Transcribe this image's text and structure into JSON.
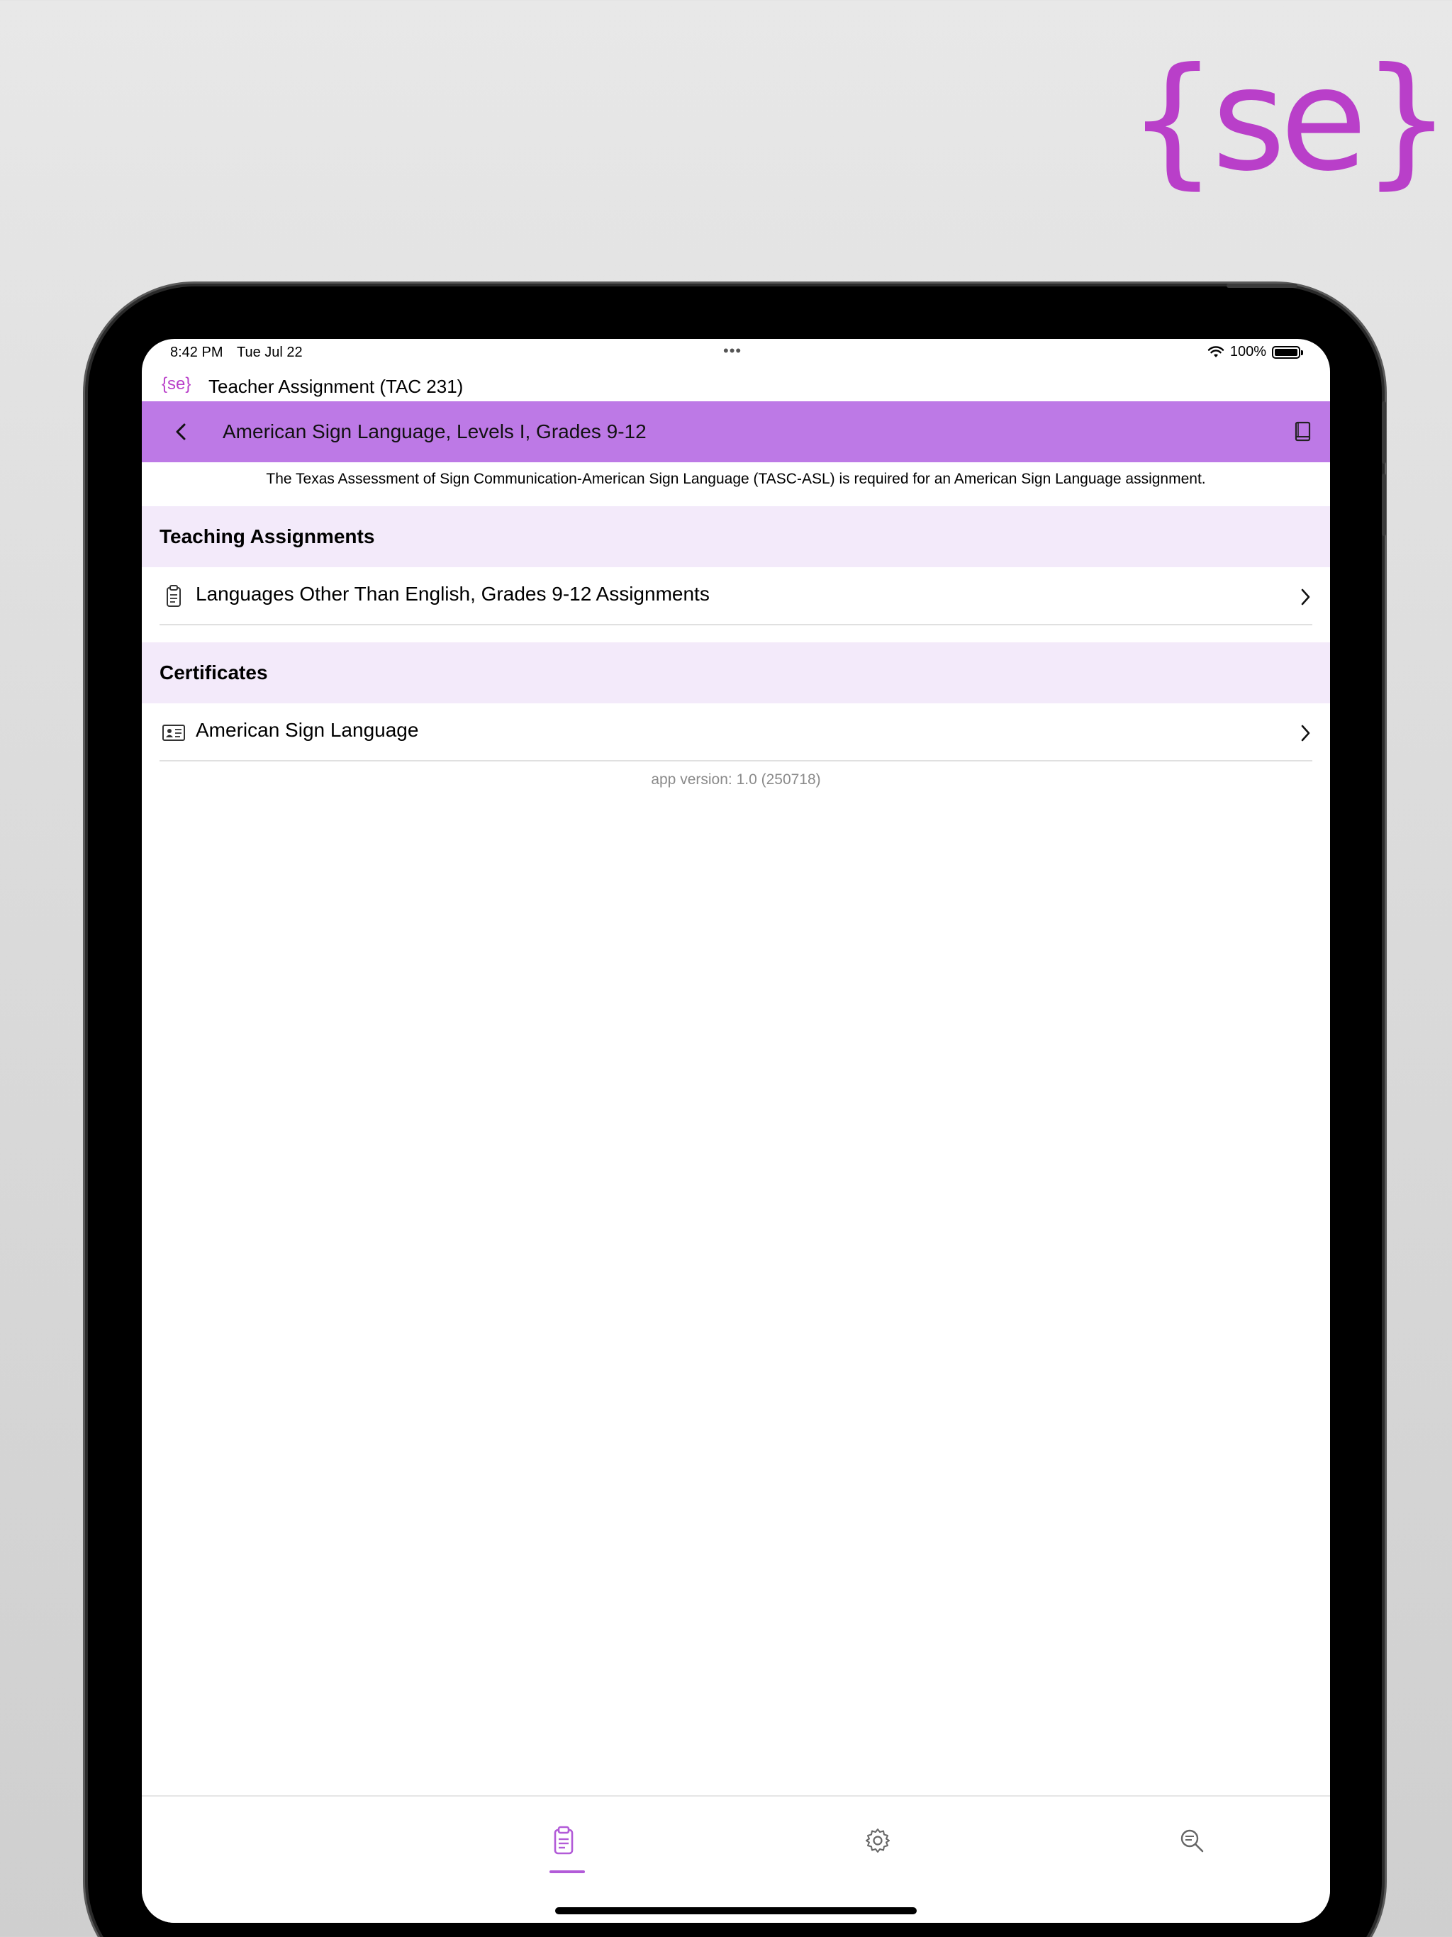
{
  "brand": {
    "logo_text": "{se}"
  },
  "status_bar": {
    "time": "8:42 PM",
    "date": "Tue Jul 22",
    "dots": "•••",
    "battery_percent": "100%",
    "wifi_icon": "wifi-icon",
    "battery_icon": "battery-icon"
  },
  "app_header": {
    "logo": "{se}",
    "title": "Teacher Assignment (TAC 231)"
  },
  "nav": {
    "title": "American Sign Language, Levels I, Grades 9-12",
    "back_icon": "chevron-left-icon",
    "book_icon": "book-icon",
    "background_color": "#bd79e6"
  },
  "notice": "The Texas Assessment of Sign Communication-American Sign Language (TASC-ASL) is required for an American Sign Language assignment.",
  "sections": [
    {
      "title": "Teaching Assignments",
      "items": [
        {
          "label": "Languages Other Than English, Grades 9-12 Assignments",
          "icon": "clipboard-icon"
        }
      ]
    },
    {
      "title": "Certificates",
      "items": [
        {
          "label": "American Sign Language",
          "icon": "id-card-icon"
        }
      ]
    }
  ],
  "version": "app version: 1.0 (250718)",
  "tab_bar": {
    "tabs": [
      {
        "icon": "clipboard-icon",
        "selected": true
      },
      {
        "icon": "gear-icon",
        "selected": false
      },
      {
        "icon": "search-icon",
        "selected": false
      }
    ],
    "accent_color": "#b25bd8"
  }
}
